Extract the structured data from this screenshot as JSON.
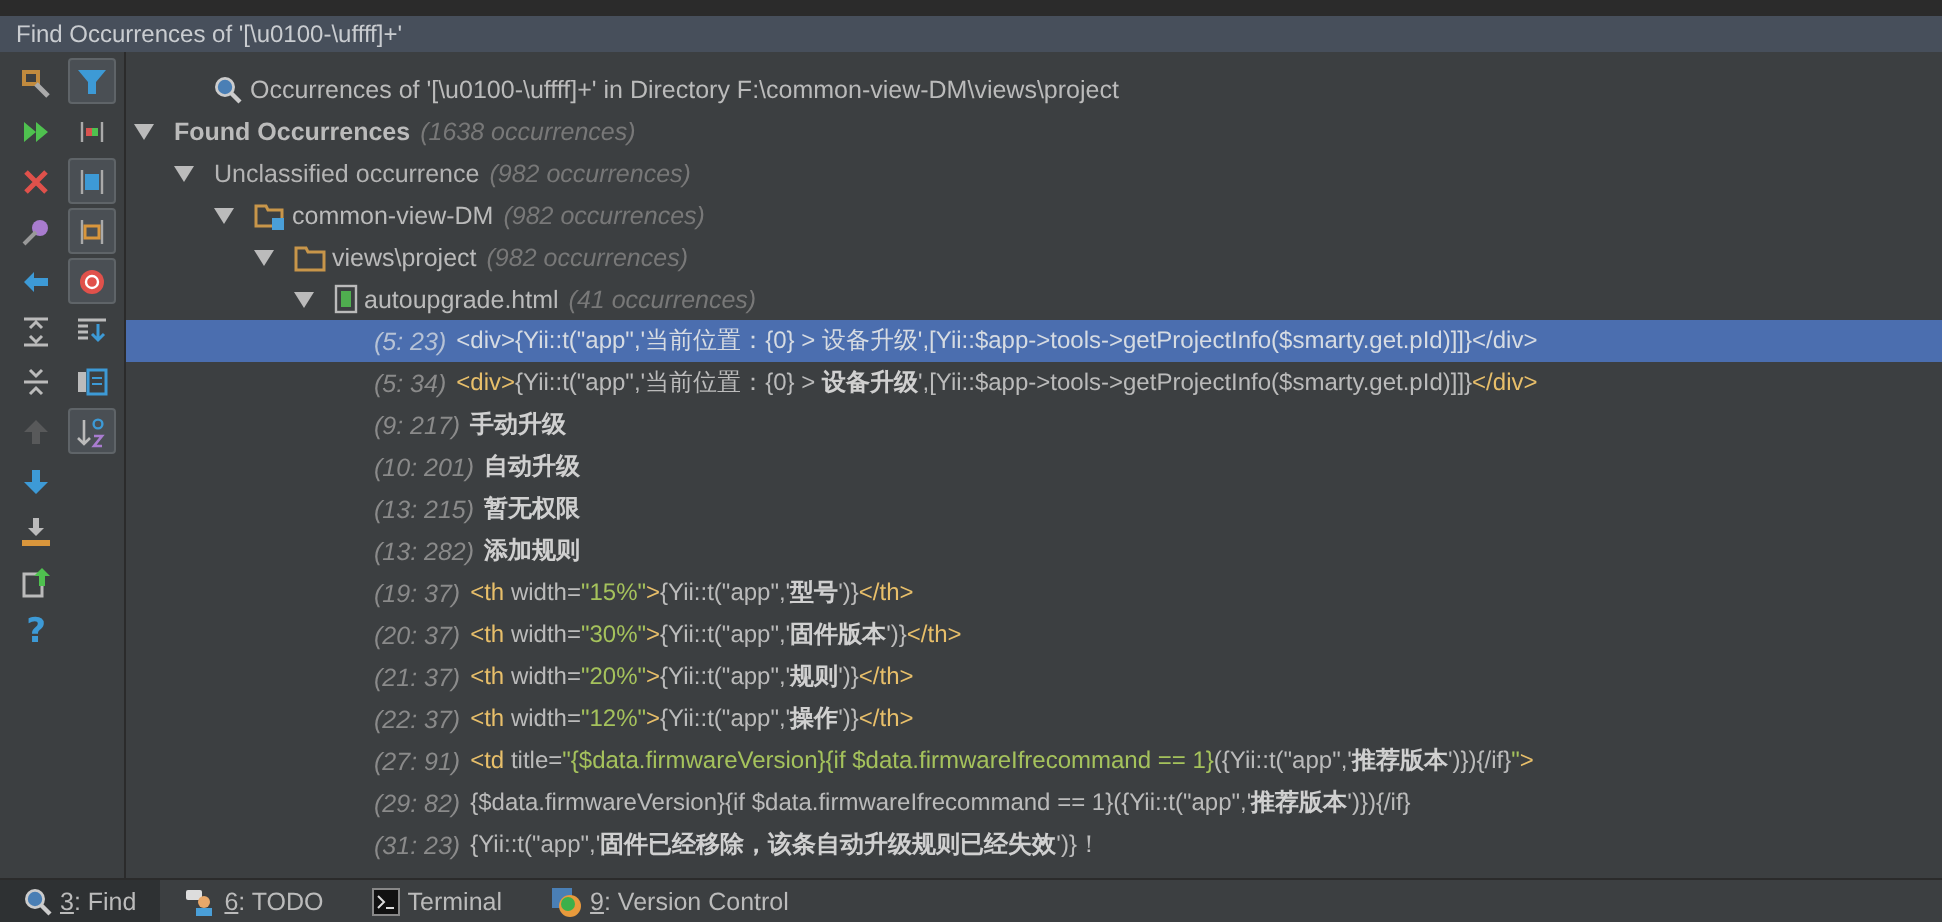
{
  "window": {
    "title": "Find Occurrences of '[\\u0100-\\uffff]+'"
  },
  "left_toolbar": {
    "column_1": [
      {
        "kind": "settings",
        "disabled": false
      },
      {
        "kind": "rerun",
        "disabled": false
      },
      {
        "kind": "close",
        "disabled": false
      },
      {
        "kind": "pin",
        "disabled": false
      },
      {
        "kind": "back",
        "disabled": false
      },
      {
        "kind": "expand",
        "disabled": false
      },
      {
        "kind": "collapse",
        "disabled": false
      },
      {
        "kind": "up",
        "disabled": true
      },
      {
        "kind": "down",
        "disabled": false
      },
      {
        "kind": "export",
        "disabled": false
      },
      {
        "kind": "open",
        "disabled": false
      },
      {
        "kind": "text",
        "label": "?",
        "disabled": false
      }
    ],
    "column_2": [
      {
        "kind": "filter",
        "on": true
      },
      {
        "kind": "merge",
        "on": false
      },
      {
        "kind": "square",
        "on": true
      },
      {
        "kind": "folder",
        "on": true
      },
      {
        "kind": "module",
        "on": true
      },
      {
        "kind": "lines",
        "on": false
      },
      {
        "kind": "preview",
        "on": false
      },
      {
        "kind": "sort",
        "on": true
      }
    ]
  },
  "results": {
    "query": "Occurrences of '[\\u0100-\\uffff]+' in Directory F:\\common-view-DM\\views\\project",
    "tree": [
      {
        "kind": "root",
        "label": "Found Occurrences",
        "count": "(1638 occurrences)",
        "expanded": true,
        "children": [
          {
            "kind": "group",
            "label": "Unclassified occurrence",
            "count": "(982 occurrences)",
            "expanded": true,
            "children": [
              {
                "kind": "module",
                "label": "common-view-DM",
                "count": "(982 occurrences)",
                "expanded": true,
                "children": [
                  {
                    "kind": "folder",
                    "label": "views\\project",
                    "count": "(982 occurrences)",
                    "expanded": true,
                    "children": [
                      {
                        "kind": "file",
                        "label": "autoupgrade.html",
                        "count": "(41 occurrences)",
                        "expanded": true,
                        "children": [
                          {
                            "kind": "occurrence",
                            "position": "(5: 23)",
                            "selected": true,
                            "segments": [
                              {
                                "kind": "tag",
                                "text": "<div>"
                              },
                              {
                                "kind": "plain",
                                "text": "{Yii::t(\"app\",'当前位置：{0} > 设备升级',[Yii::$app->tools->getProjectInfo($smarty.get.pId)]]}"
                              },
                              {
                                "kind": "tag",
                                "text": "</div>"
                              }
                            ]
                          },
                          {
                            "kind": "occurrence",
                            "position": "(5: 34)",
                            "selected": false,
                            "segments": [
                              {
                                "kind": "tag",
                                "text": "<div>"
                              },
                              {
                                "kind": "plain",
                                "text": "{Yii::t(\"app\",'当前位置：{0} > "
                              },
                              {
                                "kind": "match",
                                "text": "设备升级"
                              },
                              {
                                "kind": "plain",
                                "text": "',[Yii::$app->tools->getProjectInfo($smarty.get.pId)]]}"
                              },
                              {
                                "kind": "tag",
                                "text": "</div>"
                              }
                            ]
                          },
                          {
                            "kind": "occurrence",
                            "position": "(9: 217)",
                            "selected": false,
                            "segments": [
                              {
                                "kind": "match",
                                "text": "手动升级"
                              }
                            ]
                          },
                          {
                            "kind": "occurrence",
                            "position": "(10: 201)",
                            "selected": false,
                            "segments": [
                              {
                                "kind": "match",
                                "text": "自动升级"
                              }
                            ]
                          },
                          {
                            "kind": "occurrence",
                            "position": "(13: 215)",
                            "selected": false,
                            "segments": [
                              {
                                "kind": "match",
                                "text": "暂无权限"
                              }
                            ]
                          },
                          {
                            "kind": "occurrence",
                            "position": "(13: 282)",
                            "selected": false,
                            "segments": [
                              {
                                "kind": "match",
                                "text": "添加规则"
                              }
                            ]
                          },
                          {
                            "kind": "occurrence",
                            "position": "(19: 37)",
                            "selected": false,
                            "segments": [
                              {
                                "kind": "tag",
                                "text": "<th"
                              },
                              {
                                "kind": "plain",
                                "text": " width="
                              },
                              {
                                "kind": "string",
                                "text": "\"15%\""
                              },
                              {
                                "kind": "tag",
                                "text": ">"
                              },
                              {
                                "kind": "plain",
                                "text": "{Yii::t(\"app\",'"
                              },
                              {
                                "kind": "match",
                                "text": "型号"
                              },
                              {
                                "kind": "plain",
                                "text": "')}"
                              },
                              {
                                "kind": "tag",
                                "text": "</th>"
                              }
                            ]
                          },
                          {
                            "kind": "occurrence",
                            "position": "(20: 37)",
                            "selected": false,
                            "segments": [
                              {
                                "kind": "tag",
                                "text": "<th"
                              },
                              {
                                "kind": "plain",
                                "text": " width="
                              },
                              {
                                "kind": "string",
                                "text": "\"30%\""
                              },
                              {
                                "kind": "tag",
                                "text": ">"
                              },
                              {
                                "kind": "plain",
                                "text": "{Yii::t(\"app\",'"
                              },
                              {
                                "kind": "match",
                                "text": "固件版本"
                              },
                              {
                                "kind": "plain",
                                "text": "')}"
                              },
                              {
                                "kind": "tag",
                                "text": "</th>"
                              }
                            ]
                          },
                          {
                            "kind": "occurrence",
                            "position": "(21: 37)",
                            "selected": false,
                            "segments": [
                              {
                                "kind": "tag",
                                "text": "<th"
                              },
                              {
                                "kind": "plain",
                                "text": " width="
                              },
                              {
                                "kind": "string",
                                "text": "\"20%\""
                              },
                              {
                                "kind": "tag",
                                "text": ">"
                              },
                              {
                                "kind": "plain",
                                "text": "{Yii::t(\"app\",'"
                              },
                              {
                                "kind": "match",
                                "text": "规则"
                              },
                              {
                                "kind": "plain",
                                "text": "')}"
                              },
                              {
                                "kind": "tag",
                                "text": "</th>"
                              }
                            ]
                          },
                          {
                            "kind": "occurrence",
                            "position": "(22: 37)",
                            "selected": false,
                            "segments": [
                              {
                                "kind": "tag",
                                "text": "<th"
                              },
                              {
                                "kind": "plain",
                                "text": " width="
                              },
                              {
                                "kind": "string",
                                "text": "\"12%\""
                              },
                              {
                                "kind": "tag",
                                "text": ">"
                              },
                              {
                                "kind": "plain",
                                "text": "{Yii::t(\"app\",'"
                              },
                              {
                                "kind": "match",
                                "text": "操作"
                              },
                              {
                                "kind": "plain",
                                "text": "')}"
                              },
                              {
                                "kind": "tag",
                                "text": "</th>"
                              }
                            ]
                          },
                          {
                            "kind": "occurrence",
                            "position": "(27: 91)",
                            "selected": false,
                            "segments": [
                              {
                                "kind": "tag",
                                "text": "<td"
                              },
                              {
                                "kind": "plain",
                                "text": " title="
                              },
                              {
                                "kind": "string",
                                "text": "\"{$data.firmwareVersion}{if $data.firmwareIfrecommand == 1}"
                              },
                              {
                                "kind": "plain",
                                "text": "({Yii::t(\"app\",'"
                              },
                              {
                                "kind": "match",
                                "text": "推荐版本"
                              },
                              {
                                "kind": "plain",
                                "text": "')}){/if}"
                              },
                              {
                                "kind": "string",
                                "text": "\""
                              },
                              {
                                "kind": "tag",
                                "text": ">"
                              }
                            ]
                          },
                          {
                            "kind": "occurrence",
                            "position": "(29: 82)",
                            "selected": false,
                            "segments": [
                              {
                                "kind": "plain",
                                "text": "{$data.firmwareVersion}{if $data.firmwareIfrecommand == 1}({Yii::t(\"app\",'"
                              },
                              {
                                "kind": "match",
                                "text": "推荐版本"
                              },
                              {
                                "kind": "plain",
                                "text": "')}){/if}"
                              }
                            ]
                          },
                          {
                            "kind": "occurrence",
                            "position": "(31: 23)",
                            "selected": false,
                            "segments": [
                              {
                                "kind": "plain",
                                "text": "{Yii::t(\"app\",'"
                              },
                              {
                                "kind": "match",
                                "text": "固件已经移除，该条自动升级规则已经失效"
                              },
                              {
                                "kind": "plain",
                                "text": "')}！"
                              }
                            ]
                          }
                        ]
                      }
                    ]
                  }
                ]
              }
            ]
          }
        ]
      }
    ]
  },
  "bottom_tabs": [
    {
      "kind": "find",
      "key": "3",
      "label": ": Find",
      "selected": true
    },
    {
      "kind": "todo",
      "key": "6",
      "label": ": TODO",
      "selected": false
    },
    {
      "kind": "terminal",
      "label": "Terminal",
      "selected": false
    },
    {
      "kind": "vcs",
      "key": "9",
      "label": ": Version Control",
      "selected": false
    }
  ]
}
